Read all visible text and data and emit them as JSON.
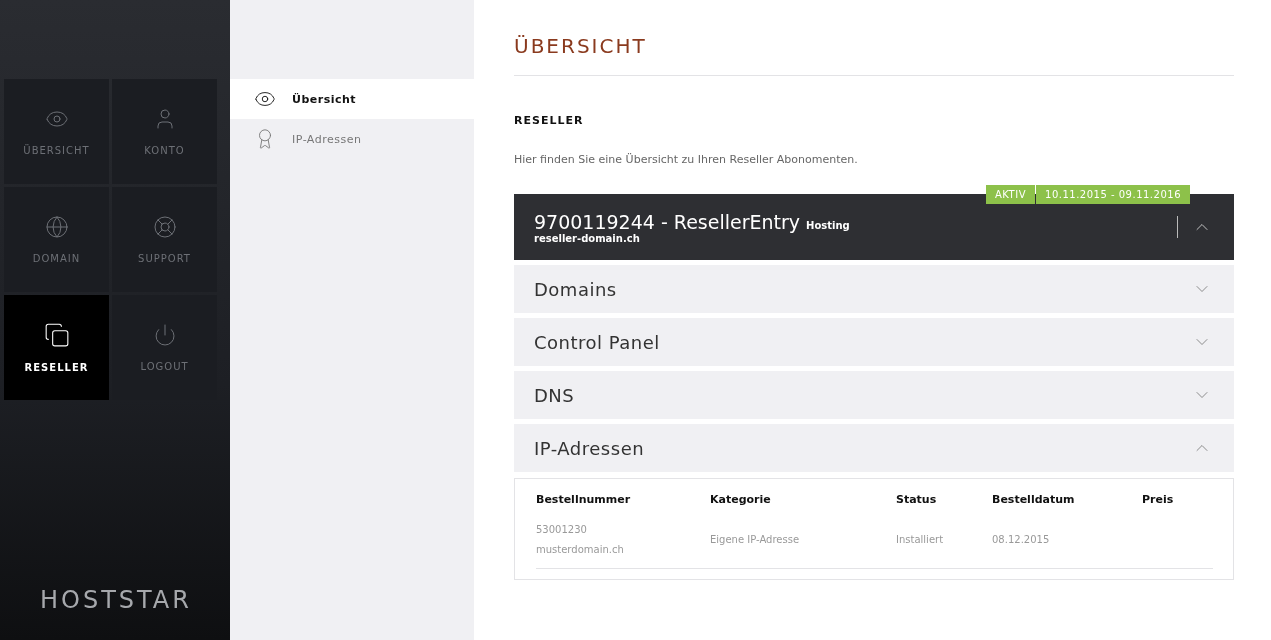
{
  "sidebar": {
    "tiles": [
      {
        "kind": "eye",
        "label": "ÜBERSICHT",
        "selected": false
      },
      {
        "kind": "user",
        "label": "KONTO",
        "selected": false
      },
      {
        "kind": "globe",
        "label": "DOMAIN",
        "selected": false
      },
      {
        "kind": "support",
        "label": "SUPPORT",
        "selected": false
      },
      {
        "kind": "copy",
        "label": "RESELLER",
        "selected": true
      },
      {
        "kind": "power",
        "label": "LOGOUT",
        "selected": false
      }
    ],
    "logo": "HOSTSTAR"
  },
  "submenu": {
    "items": [
      {
        "kind": "eye",
        "label": "Übersicht",
        "selected": true
      },
      {
        "kind": "award",
        "label": "IP-Adressen",
        "selected": false
      }
    ]
  },
  "main": {
    "title": "ÜBERSICHT",
    "section_title": "RESELLER",
    "intro": "Hier finden Sie eine Übersicht zu Ihren Reseller Abonomenten.",
    "subscription": {
      "status": "AKTIV",
      "period": "10.11.2015 - 09.11.2016",
      "title": "9700119244 - ResellerEntry",
      "type": "Hosting",
      "domain": "reseller-domain.ch",
      "expanded": true
    },
    "panels": [
      {
        "label": "Domains",
        "expanded": false
      },
      {
        "label": "Control Panel",
        "expanded": false
      },
      {
        "label": "DNS",
        "expanded": false
      },
      {
        "label": "IP-Adressen",
        "expanded": true
      }
    ],
    "table": {
      "columns": [
        "Bestellnummer",
        "Kategorie",
        "Status",
        "Bestelldatum",
        "Preis"
      ],
      "rows": [
        {
          "cells": [
            [
              "53001230",
              "musterdomain.ch"
            ],
            "Eigene IP-Adresse",
            "Installiert",
            "08.12.2015",
            ""
          ]
        }
      ]
    }
  }
}
